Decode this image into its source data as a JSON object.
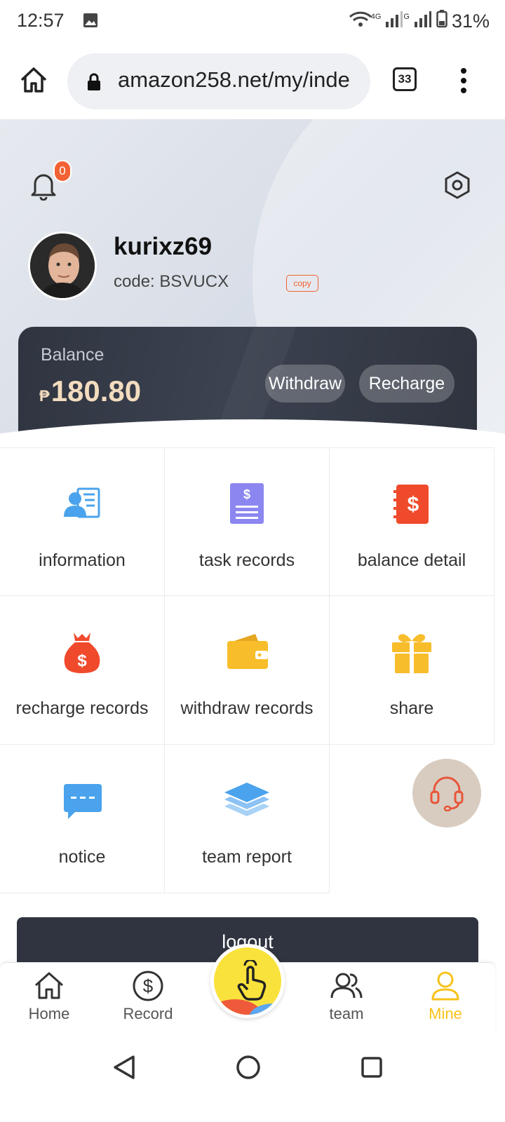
{
  "status_bar": {
    "time": "12:57",
    "net_type": "4G",
    "sim2_type": "G",
    "battery": "31%"
  },
  "browser": {
    "url": "amazon258.net/my/inde",
    "tab_count": "33"
  },
  "header": {
    "notifications": "0",
    "username": "kurixz69",
    "code_text": "code: BSVUCX",
    "copy_label": "copy"
  },
  "balance": {
    "label": "Balance",
    "currency": "₱",
    "amount": "180.80",
    "withdraw_label": "Withdraw",
    "recharge_label": "Recharge"
  },
  "menu": [
    {
      "label": "information",
      "icon": "id-card-icon",
      "color": "#4aa3ec"
    },
    {
      "label": "task records",
      "icon": "document-dollar-icon",
      "color": "#8c86f0"
    },
    {
      "label": "balance detail",
      "icon": "ledger-dollar-icon",
      "color": "#f04a2c"
    },
    {
      "label": "recharge records",
      "icon": "money-bag-icon",
      "color": "#f04a2c"
    },
    {
      "label": "withdraw records",
      "icon": "wallet-icon",
      "color": "#f7bd2b"
    },
    {
      "label": "share",
      "icon": "gift-icon",
      "color": "#f7bd2b"
    },
    {
      "label": "notice",
      "icon": "chat-bubble-icon",
      "color": "#4aa3ec"
    },
    {
      "label": "team report",
      "icon": "layers-icon",
      "color": "#4aa3ec"
    }
  ],
  "logout_label": "logout",
  "bottom_nav": {
    "home": "Home",
    "record": "Record",
    "team": "team",
    "mine": "Mine"
  },
  "colors": {
    "accent": "#f7c21b",
    "card_dark": "#2f3440",
    "badge": "#f26133"
  }
}
